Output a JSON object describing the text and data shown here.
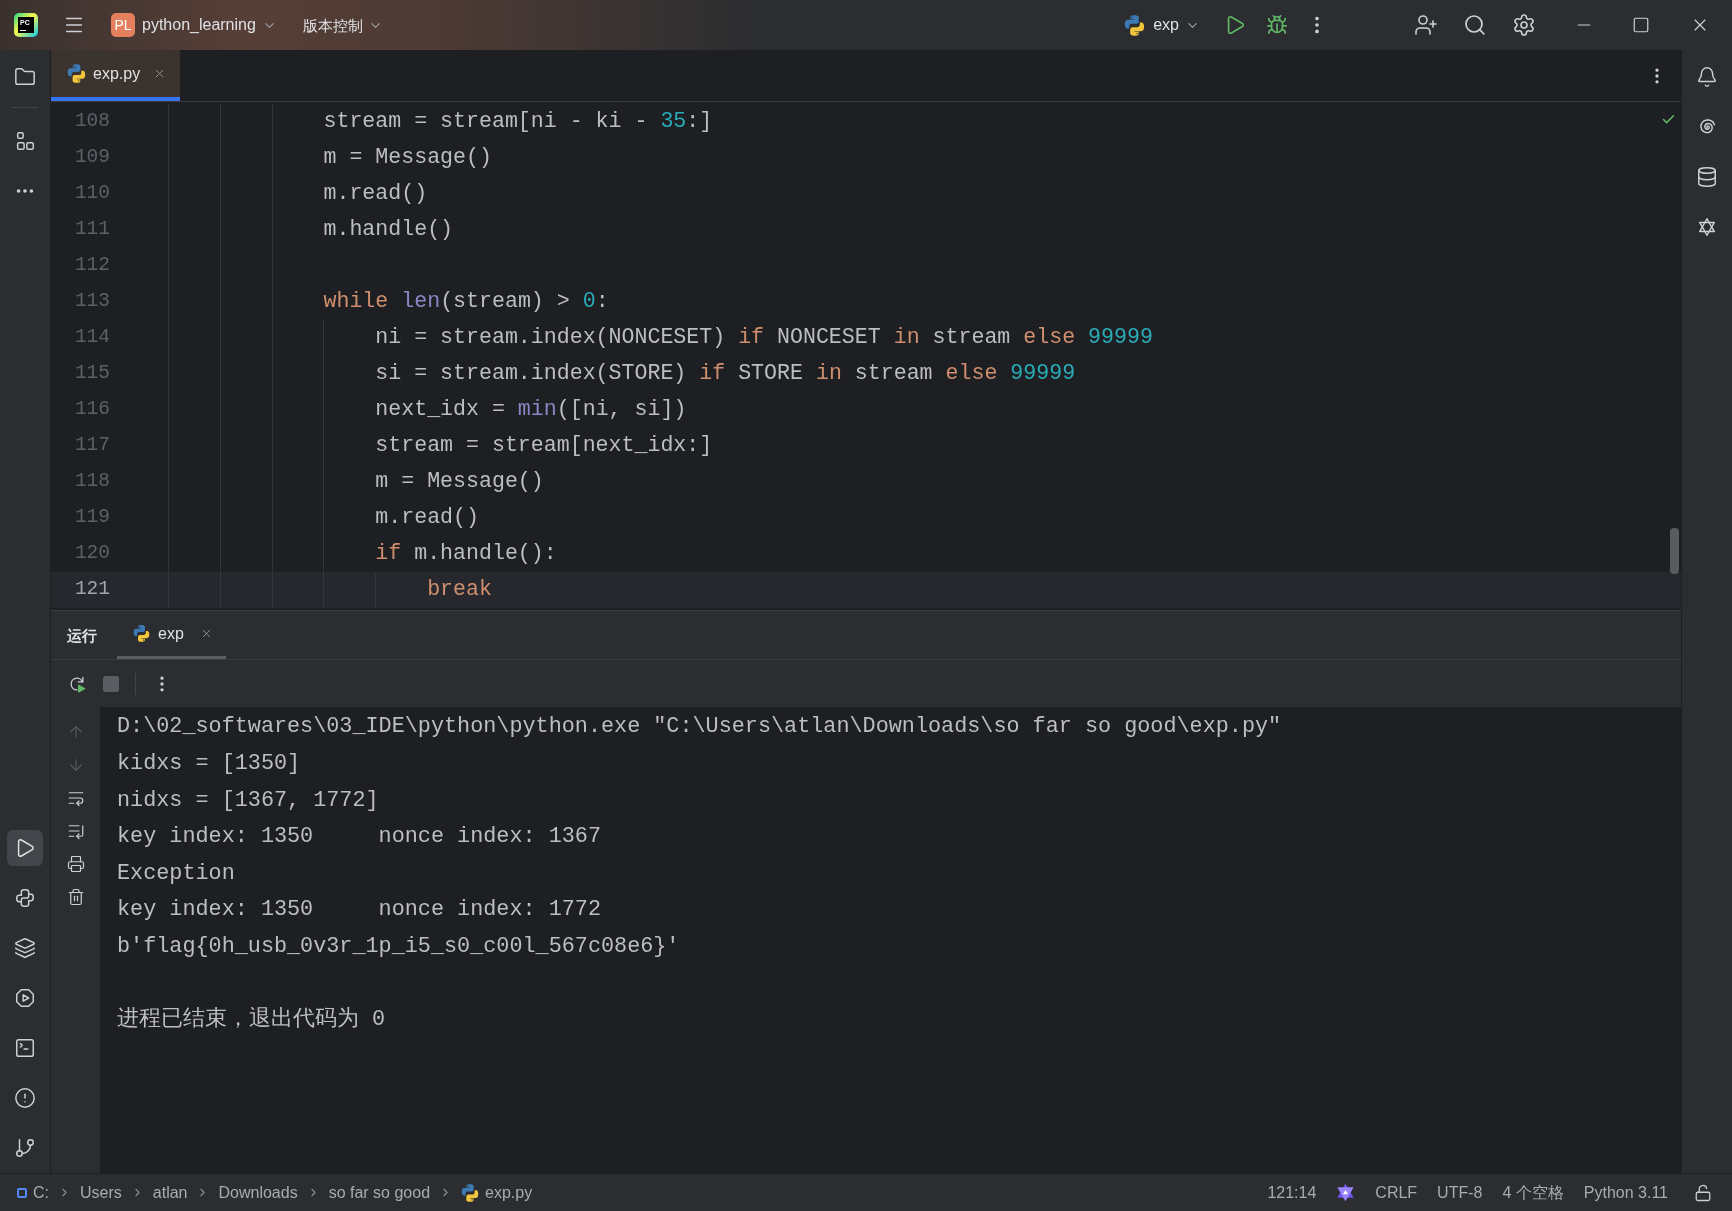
{
  "title_bar": {
    "logo_text": "PC",
    "project_badge": "PL",
    "project_name": "python_learning",
    "vcs_menu": "版本控制",
    "run_config": "exp"
  },
  "left_toolbar": {
    "top": [
      {
        "kind": "project",
        "selected": false
      },
      {
        "kind": "structure",
        "selected": false
      },
      {
        "kind": "more",
        "selected": false
      }
    ],
    "bottom": [
      {
        "kind": "run",
        "selected": true
      },
      {
        "kind": "python_console",
        "selected": false
      },
      {
        "kind": "layers",
        "selected": false
      },
      {
        "kind": "services",
        "selected": false
      },
      {
        "kind": "terminal",
        "selected": false
      },
      {
        "kind": "problems",
        "selected": false
      },
      {
        "kind": "git",
        "selected": false
      }
    ]
  },
  "editor": {
    "tabs": [
      {
        "label": "exp.py",
        "selected": true
      }
    ],
    "lines": [
      {
        "number": "108",
        "current": false,
        "tokens": [
          {
            "text": "stream = stream[ni - ki - ",
            "kind": "plain"
          },
          {
            "text": "35",
            "kind": "number"
          },
          {
            "text": ":]",
            "kind": "plain"
          }
        ]
      },
      {
        "number": "109",
        "current": false,
        "tokens": [
          {
            "text": "m = Message()",
            "kind": "plain"
          }
        ]
      },
      {
        "number": "110",
        "current": false,
        "tokens": [
          {
            "text": "m.read()",
            "kind": "plain"
          }
        ]
      },
      {
        "number": "111",
        "current": false,
        "tokens": [
          {
            "text": "m.handle()",
            "kind": "plain"
          }
        ]
      },
      {
        "number": "112",
        "current": false
      },
      {
        "number": "113",
        "current": false,
        "tokens": [
          {
            "text": "while ",
            "kind": "keyword"
          },
          {
            "text": "len",
            "kind": "builtin"
          },
          {
            "text": "(stream) > ",
            "kind": "plain"
          },
          {
            "text": "0",
            "kind": "number"
          },
          {
            "text": ":",
            "kind": "plain"
          }
        ],
        "children": [
          {
            "number": "114",
            "current": false,
            "tokens": [
              {
                "text": "ni = stream.index(NONCESET) ",
                "kind": "plain"
              },
              {
                "text": "if",
                "kind": "keyword"
              },
              {
                "text": " NONCESET ",
                "kind": "plain"
              },
              {
                "text": "in",
                "kind": "keyword"
              },
              {
                "text": " stream ",
                "kind": "plain"
              },
              {
                "text": "else ",
                "kind": "keyword"
              },
              {
                "text": "99999",
                "kind": "number"
              }
            ]
          },
          {
            "number": "115",
            "current": false,
            "tokens": [
              {
                "text": "si = stream.index(STORE) ",
                "kind": "plain"
              },
              {
                "text": "if",
                "kind": "keyword"
              },
              {
                "text": " STORE ",
                "kind": "plain"
              },
              {
                "text": "in",
                "kind": "keyword"
              },
              {
                "text": " stream ",
                "kind": "plain"
              },
              {
                "text": "else ",
                "kind": "keyword"
              },
              {
                "text": "99999",
                "kind": "number"
              }
            ]
          },
          {
            "number": "116",
            "current": false,
            "tokens": [
              {
                "text": "next_idx = ",
                "kind": "plain"
              },
              {
                "text": "min",
                "kind": "builtin"
              },
              {
                "text": "([ni, si])",
                "kind": "plain"
              }
            ]
          },
          {
            "number": "117",
            "current": false,
            "tokens": [
              {
                "text": "stream = stream[next_idx:]",
                "kind": "plain"
              }
            ]
          },
          {
            "number": "118",
            "current": false,
            "tokens": [
              {
                "text": "m = Message()",
                "kind": "plain"
              }
            ]
          },
          {
            "number": "119",
            "current": false,
            "tokens": [
              {
                "text": "m.read()",
                "kind": "plain"
              }
            ]
          },
          {
            "number": "120",
            "current": false,
            "tokens": [
              {
                "text": "if ",
                "kind": "keyword"
              },
              {
                "text": "m.handle():",
                "kind": "plain"
              }
            ],
            "children": [
              {
                "number": "121",
                "current": true,
                "tokens": [
                  {
                    "text": "break",
                    "kind": "keyword"
                  }
                ]
              }
            ]
          }
        ]
      }
    ]
  },
  "run_panel": {
    "title": "运行",
    "tabs": [
      {
        "label": "exp",
        "selected": true
      }
    ],
    "toolbar": [
      {
        "kind": "rerun",
        "disabled": false
      },
      {
        "kind": "stop",
        "disabled": true
      },
      {
        "kind": "more",
        "disabled": false
      }
    ],
    "gutter": [
      {
        "kind": "up",
        "disabled": true
      },
      {
        "kind": "down",
        "disabled": true
      },
      {
        "kind": "wrap",
        "disabled": false
      },
      {
        "kind": "scroll_end",
        "disabled": false
      },
      {
        "kind": "print",
        "disabled": false
      },
      {
        "kind": "clear",
        "disabled": false
      }
    ],
    "output": [
      "D:\\02_softwares\\03_IDE\\python\\python.exe \"C:\\Users\\atlan\\Downloads\\so far so good\\exp.py\"",
      "kidxs = [1350]",
      "nidxs = [1367, 1772]",
      "key index: 1350     nonce index: 1367",
      "Exception",
      "key index: 1350     nonce index: 1772",
      "b'flag{0h_usb_0v3r_1p_i5_s0_c00l_567c08e6}'"
    ],
    "exit_message": "进程已结束，退出代码为 0"
  },
  "right_toolbar": [
    {
      "kind": "notifications"
    },
    {
      "kind": "ai_assistant"
    },
    {
      "kind": "database"
    },
    {
      "kind": "ai_chat"
    }
  ],
  "status_bar": {
    "breadcrumbs": [
      {
        "kind": "drive",
        "label": "C:"
      },
      {
        "kind": "folder",
        "label": "Users"
      },
      {
        "kind": "folder",
        "label": "atlan"
      },
      {
        "kind": "folder",
        "label": "Downloads"
      },
      {
        "kind": "folder",
        "label": "so far so good"
      },
      {
        "kind": "file",
        "label": "exp.py"
      }
    ],
    "position": "121:14",
    "line_separator": "CRLF",
    "encoding": "UTF-8",
    "indent": "4 个空格",
    "interpreter": "Python 3.11"
  }
}
